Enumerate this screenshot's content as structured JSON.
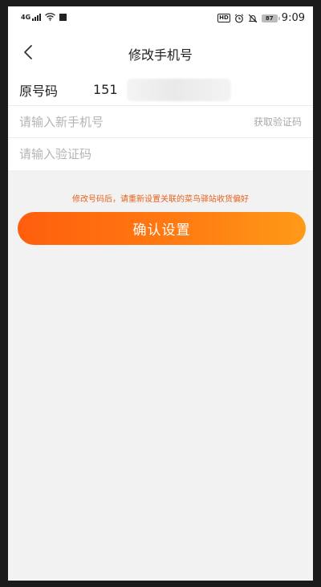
{
  "status_bar": {
    "network_label": "4G",
    "hd_badge": "HD",
    "battery_level": "87",
    "time": "9:09",
    "icons": [
      "signal-icon",
      "wifi-icon",
      "notification-square-icon",
      "alarm-icon",
      "mute-icon",
      "battery-icon"
    ]
  },
  "nav": {
    "title": "修改手机号",
    "back_icon": "chevron-left-icon"
  },
  "form": {
    "original": {
      "label": "原号码",
      "value": "151"
    },
    "new_phone": {
      "placeholder": "请输入新手机号",
      "value": "",
      "get_code_label": "获取验证码"
    },
    "code": {
      "placeholder": "请输入验证码",
      "value": ""
    }
  },
  "tip": "修改号码后，请重新设置关联的菜鸟驿站收货偏好",
  "confirm_label": "确认设置",
  "colors": {
    "accent": "#ff6a0f",
    "tip": "#e8611d",
    "background": "#f2f2f2"
  }
}
